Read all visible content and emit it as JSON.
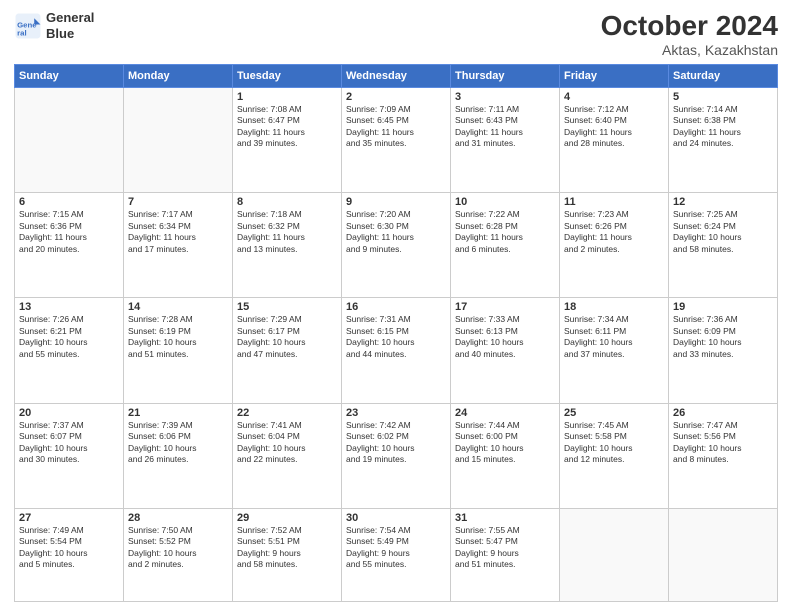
{
  "header": {
    "logo_line1": "General",
    "logo_line2": "Blue",
    "month": "October 2024",
    "location": "Aktas, Kazakhstan"
  },
  "days_of_week": [
    "Sunday",
    "Monday",
    "Tuesday",
    "Wednesday",
    "Thursday",
    "Friday",
    "Saturday"
  ],
  "weeks": [
    [
      {
        "day": "",
        "info": ""
      },
      {
        "day": "",
        "info": ""
      },
      {
        "day": "1",
        "info": "Sunrise: 7:08 AM\nSunset: 6:47 PM\nDaylight: 11 hours\nand 39 minutes."
      },
      {
        "day": "2",
        "info": "Sunrise: 7:09 AM\nSunset: 6:45 PM\nDaylight: 11 hours\nand 35 minutes."
      },
      {
        "day": "3",
        "info": "Sunrise: 7:11 AM\nSunset: 6:43 PM\nDaylight: 11 hours\nand 31 minutes."
      },
      {
        "day": "4",
        "info": "Sunrise: 7:12 AM\nSunset: 6:40 PM\nDaylight: 11 hours\nand 28 minutes."
      },
      {
        "day": "5",
        "info": "Sunrise: 7:14 AM\nSunset: 6:38 PM\nDaylight: 11 hours\nand 24 minutes."
      }
    ],
    [
      {
        "day": "6",
        "info": "Sunrise: 7:15 AM\nSunset: 6:36 PM\nDaylight: 11 hours\nand 20 minutes."
      },
      {
        "day": "7",
        "info": "Sunrise: 7:17 AM\nSunset: 6:34 PM\nDaylight: 11 hours\nand 17 minutes."
      },
      {
        "day": "8",
        "info": "Sunrise: 7:18 AM\nSunset: 6:32 PM\nDaylight: 11 hours\nand 13 minutes."
      },
      {
        "day": "9",
        "info": "Sunrise: 7:20 AM\nSunset: 6:30 PM\nDaylight: 11 hours\nand 9 minutes."
      },
      {
        "day": "10",
        "info": "Sunrise: 7:22 AM\nSunset: 6:28 PM\nDaylight: 11 hours\nand 6 minutes."
      },
      {
        "day": "11",
        "info": "Sunrise: 7:23 AM\nSunset: 6:26 PM\nDaylight: 11 hours\nand 2 minutes."
      },
      {
        "day": "12",
        "info": "Sunrise: 7:25 AM\nSunset: 6:24 PM\nDaylight: 10 hours\nand 58 minutes."
      }
    ],
    [
      {
        "day": "13",
        "info": "Sunrise: 7:26 AM\nSunset: 6:21 PM\nDaylight: 10 hours\nand 55 minutes."
      },
      {
        "day": "14",
        "info": "Sunrise: 7:28 AM\nSunset: 6:19 PM\nDaylight: 10 hours\nand 51 minutes."
      },
      {
        "day": "15",
        "info": "Sunrise: 7:29 AM\nSunset: 6:17 PM\nDaylight: 10 hours\nand 47 minutes."
      },
      {
        "day": "16",
        "info": "Sunrise: 7:31 AM\nSunset: 6:15 PM\nDaylight: 10 hours\nand 44 minutes."
      },
      {
        "day": "17",
        "info": "Sunrise: 7:33 AM\nSunset: 6:13 PM\nDaylight: 10 hours\nand 40 minutes."
      },
      {
        "day": "18",
        "info": "Sunrise: 7:34 AM\nSunset: 6:11 PM\nDaylight: 10 hours\nand 37 minutes."
      },
      {
        "day": "19",
        "info": "Sunrise: 7:36 AM\nSunset: 6:09 PM\nDaylight: 10 hours\nand 33 minutes."
      }
    ],
    [
      {
        "day": "20",
        "info": "Sunrise: 7:37 AM\nSunset: 6:07 PM\nDaylight: 10 hours\nand 30 minutes."
      },
      {
        "day": "21",
        "info": "Sunrise: 7:39 AM\nSunset: 6:06 PM\nDaylight: 10 hours\nand 26 minutes."
      },
      {
        "day": "22",
        "info": "Sunrise: 7:41 AM\nSunset: 6:04 PM\nDaylight: 10 hours\nand 22 minutes."
      },
      {
        "day": "23",
        "info": "Sunrise: 7:42 AM\nSunset: 6:02 PM\nDaylight: 10 hours\nand 19 minutes."
      },
      {
        "day": "24",
        "info": "Sunrise: 7:44 AM\nSunset: 6:00 PM\nDaylight: 10 hours\nand 15 minutes."
      },
      {
        "day": "25",
        "info": "Sunrise: 7:45 AM\nSunset: 5:58 PM\nDaylight: 10 hours\nand 12 minutes."
      },
      {
        "day": "26",
        "info": "Sunrise: 7:47 AM\nSunset: 5:56 PM\nDaylight: 10 hours\nand 8 minutes."
      }
    ],
    [
      {
        "day": "27",
        "info": "Sunrise: 7:49 AM\nSunset: 5:54 PM\nDaylight: 10 hours\nand 5 minutes."
      },
      {
        "day": "28",
        "info": "Sunrise: 7:50 AM\nSunset: 5:52 PM\nDaylight: 10 hours\nand 2 minutes."
      },
      {
        "day": "29",
        "info": "Sunrise: 7:52 AM\nSunset: 5:51 PM\nDaylight: 9 hours\nand 58 minutes."
      },
      {
        "day": "30",
        "info": "Sunrise: 7:54 AM\nSunset: 5:49 PM\nDaylight: 9 hours\nand 55 minutes."
      },
      {
        "day": "31",
        "info": "Sunrise: 7:55 AM\nSunset: 5:47 PM\nDaylight: 9 hours\nand 51 minutes."
      },
      {
        "day": "",
        "info": ""
      },
      {
        "day": "",
        "info": ""
      }
    ]
  ]
}
